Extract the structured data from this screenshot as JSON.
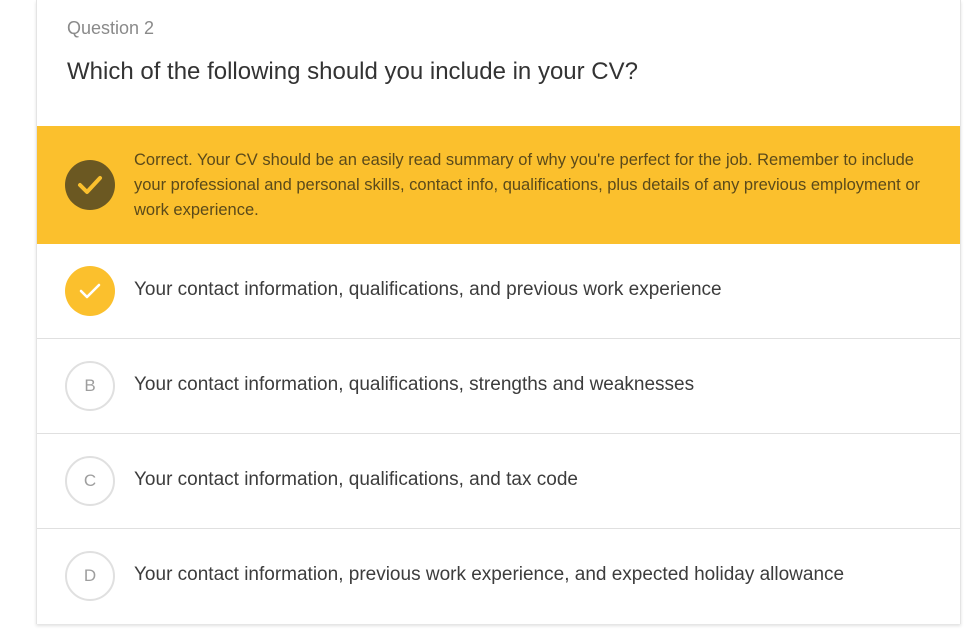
{
  "question": {
    "number_label": "Question 2",
    "title": "Which of the following should you include in your CV?"
  },
  "feedback": {
    "icon": "checkmark-icon",
    "text": "Correct. Your CV should be an easily read summary of why you're perfect for the job. Remember to include your professional and personal skills, contact info, qualifications, plus details of any previous employment or work experience.",
    "color": "#fbc02d"
  },
  "options": [
    {
      "marker": "",
      "icon": "checkmark-icon",
      "text": "Your contact information, qualifications, and previous work experience",
      "selected": true
    },
    {
      "marker": "B",
      "text": "Your contact information, qualifications, strengths and weaknesses",
      "selected": false
    },
    {
      "marker": "C",
      "text": "Your contact information, qualifications, and tax code",
      "selected": false
    },
    {
      "marker": "D",
      "text": "Your contact information, previous work experience, and expected holiday allowance",
      "selected": false
    }
  ]
}
